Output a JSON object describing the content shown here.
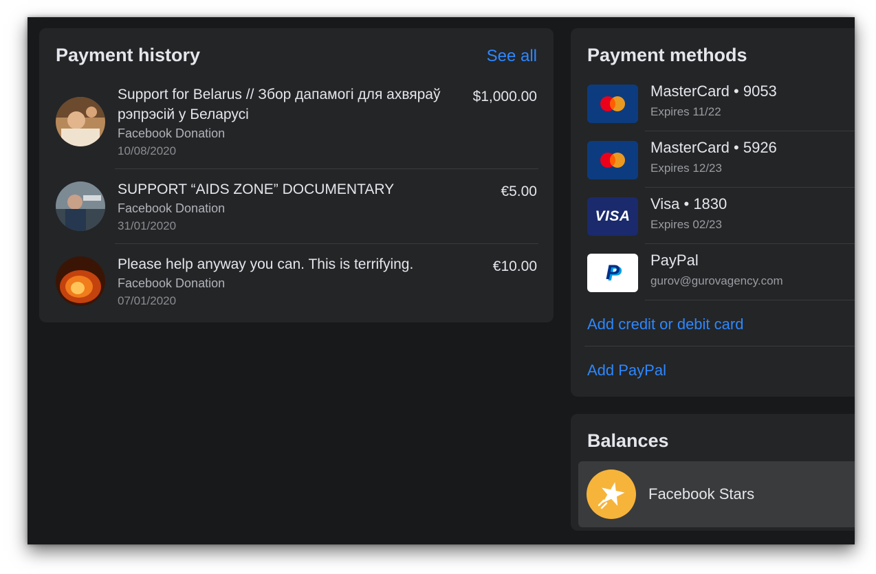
{
  "payment_history": {
    "title": "Payment history",
    "see_all": "See all",
    "items": [
      {
        "title": "Support for Belarus // Збор дапамогі для ахвяраў рэпрэсій у Беларусі",
        "subtitle": "Facebook Donation",
        "date": "10/08/2020",
        "amount": "$1,000.00"
      },
      {
        "title": "SUPPORT “AIDS ZONE” DOCUMENTARY",
        "subtitle": "Facebook Donation",
        "date": "31/01/2020",
        "amount": "€5.00"
      },
      {
        "title": "Please help anyway you can. This is terrifying.",
        "subtitle": "Facebook Donation",
        "date": "07/01/2020",
        "amount": "€10.00"
      }
    ]
  },
  "payment_methods": {
    "title": "Payment methods",
    "methods": [
      {
        "name": "MasterCard • 9053",
        "detail": "Expires 11/22",
        "icon": "mastercard-icon"
      },
      {
        "name": "MasterCard • 5926",
        "detail": "Expires 12/23",
        "icon": "mastercard-icon"
      },
      {
        "name": "Visa • 1830",
        "detail": "Expires 02/23",
        "icon": "visa-icon",
        "icon_text": "VISA"
      },
      {
        "name": "PayPal",
        "detail": "gurov@gurovagency.com",
        "icon": "paypal-icon",
        "icon_text": "P"
      }
    ],
    "add_card": "Add credit or debit card",
    "add_paypal": "Add PayPal"
  },
  "balances": {
    "title": "Balances",
    "items": [
      {
        "label": "Facebook Stars",
        "icon": "star-icon"
      }
    ]
  },
  "colors": {
    "background": "#18191b",
    "card": "#242527",
    "link": "#2d88ff",
    "mastercard_bg": "#0c3c7f",
    "visa_bg": "#1a2a6c",
    "stars": "#f7b43a"
  }
}
